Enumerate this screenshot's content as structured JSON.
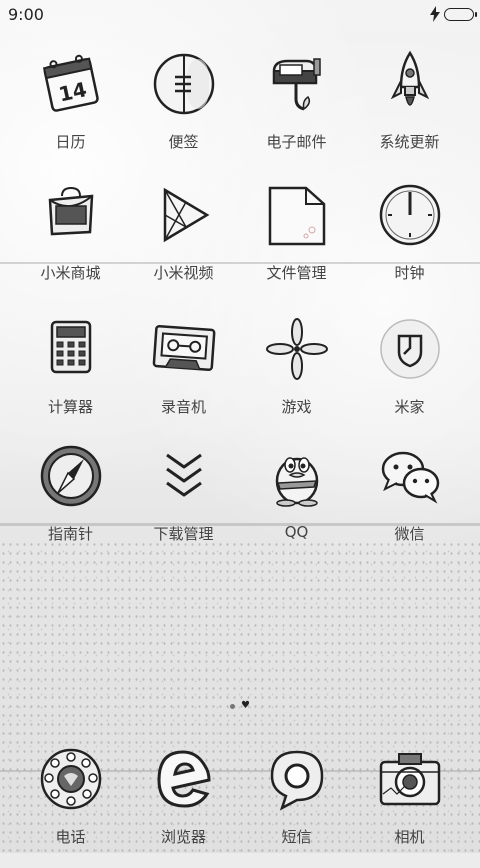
{
  "status_bar": {
    "time": "9:00",
    "icons": [
      "charging-icon",
      "battery-icon"
    ]
  },
  "home": {
    "rows": [
      [
        {
          "label": "日历",
          "icon": "calendar-icon",
          "icon_text": "14"
        },
        {
          "label": "便签",
          "icon": "notes-icon"
        },
        {
          "label": "电子邮件",
          "icon": "mailbox-icon"
        },
        {
          "label": "系统更新",
          "icon": "rocket-icon"
        }
      ],
      [
        {
          "label": "小米商城",
          "icon": "shopping-bag-icon"
        },
        {
          "label": "小米视频",
          "icon": "play-icon"
        },
        {
          "label": "文件管理",
          "icon": "folder-icon"
        },
        {
          "label": "时钟",
          "icon": "clock-icon"
        }
      ],
      [
        {
          "label": "计算器",
          "icon": "calculator-icon"
        },
        {
          "label": "录音机",
          "icon": "cassette-icon"
        },
        {
          "label": "游戏",
          "icon": "pinwheel-icon"
        },
        {
          "label": "米家",
          "icon": "mijia-icon"
        }
      ],
      [
        {
          "label": "指南针",
          "icon": "compass-icon"
        },
        {
          "label": "下载管理",
          "icon": "download-chevrons-icon"
        },
        {
          "label": "QQ",
          "icon": "qq-penguin-icon"
        },
        {
          "label": "微信",
          "icon": "wechat-icon"
        }
      ]
    ],
    "page_indicator": {
      "pages": 2,
      "current": 2
    }
  },
  "dock": [
    {
      "label": "电话",
      "icon": "rotary-phone-icon"
    },
    {
      "label": "浏览器",
      "icon": "browser-icon"
    },
    {
      "label": "短信",
      "icon": "message-bubble-icon"
    },
    {
      "label": "相机",
      "icon": "camera-icon"
    }
  ],
  "colors": {
    "ink": "#222222",
    "label": "#444444",
    "wallpaper": "#ececec"
  }
}
